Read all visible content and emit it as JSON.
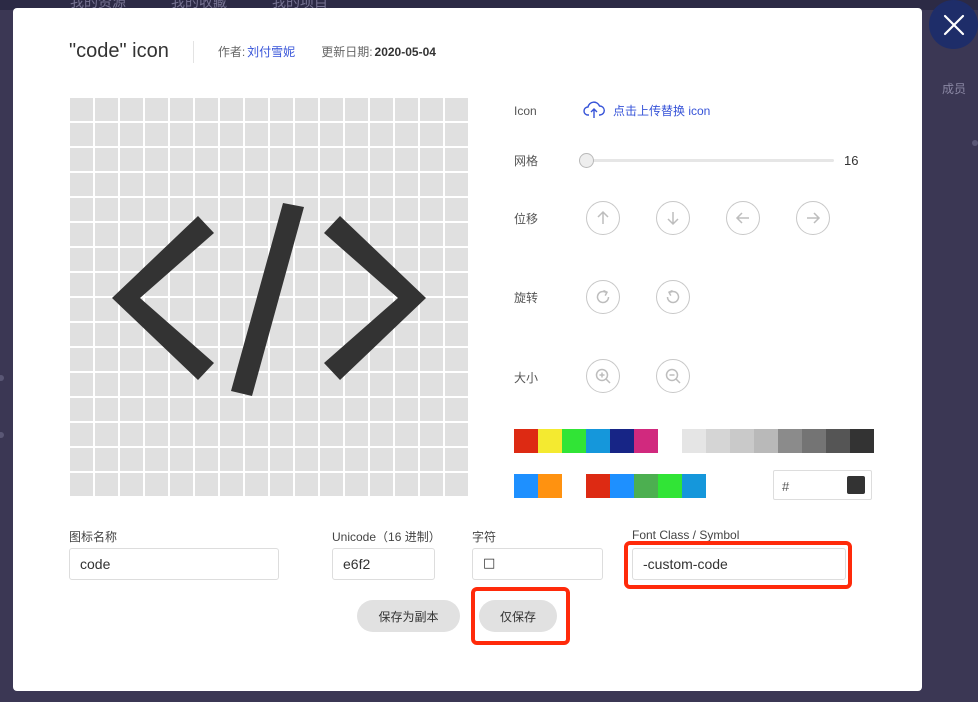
{
  "background": {
    "nav_items": [
      "我的资源",
      "我的收藏",
      "我的项目"
    ],
    "right_text": "成员"
  },
  "modal": {
    "title": "\"code\"  icon",
    "author_label": "作者:",
    "author_name": "刘付雪妮",
    "date_label": "更新日期:",
    "date_value": "2020-05-04"
  },
  "controls": {
    "icon_label": "Icon",
    "upload_text": "点击上传替换 icon",
    "grid_label": "网格",
    "grid_value": "16",
    "grid_fraction": 0.0,
    "shift_label": "位移",
    "rotate_label": "旋转",
    "size_label": "大小"
  },
  "icons": {
    "close": "close-icon",
    "upload": "cloud-upload-icon",
    "shift": [
      "arrow-up-icon",
      "arrow-down-icon",
      "arrow-left-icon",
      "arrow-right-icon"
    ],
    "rotate": [
      "rotate-cw-icon",
      "rotate-ccw-icon"
    ],
    "zoom": [
      "zoom-in-icon",
      "zoom-out-icon"
    ],
    "glyph": "code-icon"
  },
  "colors": {
    "accent": "#3653d8",
    "highlight": "#ff2a0a",
    "icon_fill": "#333333",
    "palette_row1": [
      "#dd2a13",
      "#f4ea30",
      "#31e436",
      "#1597db",
      "#172586",
      "#d1297e"
    ],
    "grays": [
      "#e5e5e5",
      "#d5d5d5",
      "#c9c9c9",
      "#b9b9b9",
      "#8b8b8b",
      "#747474",
      "#555555",
      "#333333"
    ],
    "palette_row2a": [
      "#1e90ff",
      "#ff9210"
    ],
    "palette_row2b": [
      "#dd2a13",
      "#1e90ff",
      "#4caf50",
      "#31e436",
      "#1597db"
    ]
  },
  "hex_input": {
    "hash": "#",
    "value": ""
  },
  "fields": {
    "name_label": "图标名称",
    "name_value": "code",
    "unicode_label": "Unicode（16 进制）",
    "unicode_value": "e6f2",
    "char_label": "字符",
    "char_value": "□",
    "fontclass_label": "Font Class / Symbol",
    "fontclass_value": "-custom-code"
  },
  "buttons": {
    "save_copy": "保存为副本",
    "save_only": "仅保存"
  }
}
